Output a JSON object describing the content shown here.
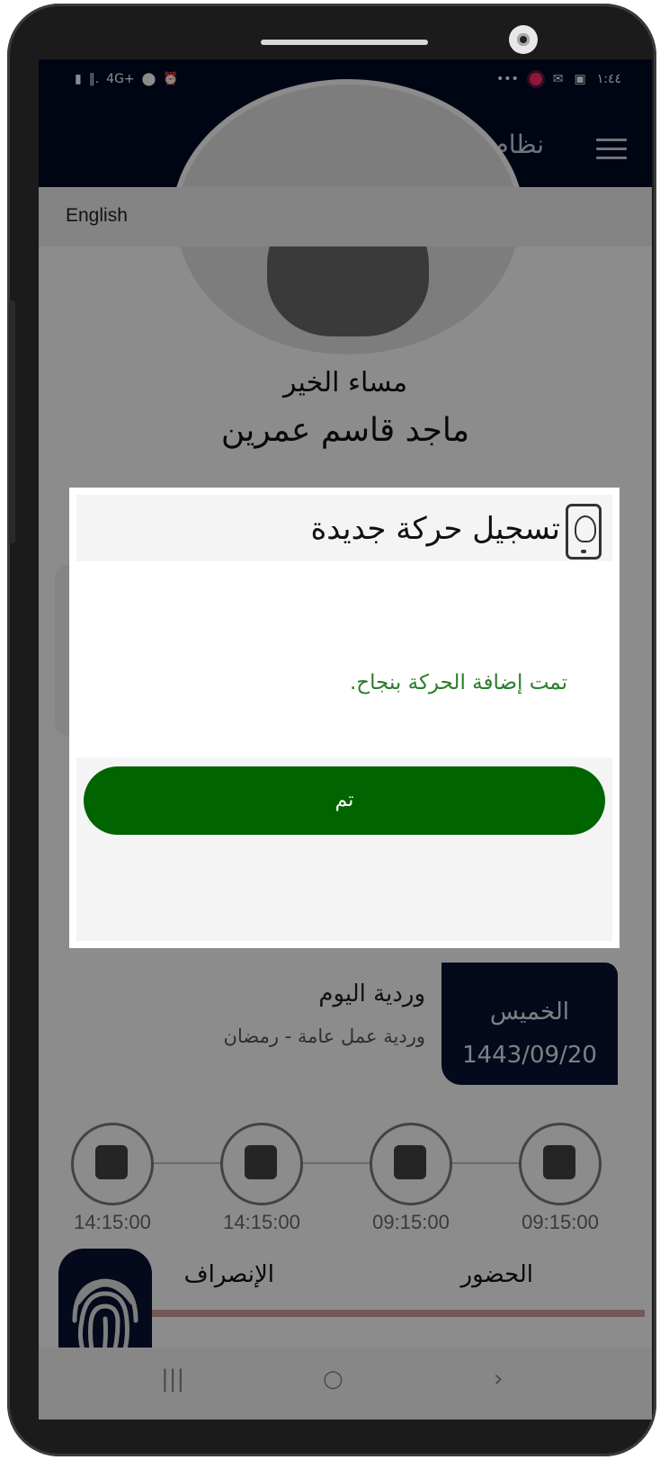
{
  "status_bar": {
    "left_icons": [
      "battery-icon",
      "signal-icon",
      "4g-icon",
      "location-icon",
      "alarm-icon"
    ],
    "left_text": "4G+",
    "right_icons": [
      "more-icon",
      "record-icon",
      "mail-icon",
      "image-icon"
    ],
    "time": "١:٤٤"
  },
  "app_bar": {
    "title": "نظام الحضور والإنصراف",
    "menu_icon": "menu-icon"
  },
  "language": {
    "label": "English"
  },
  "profile": {
    "greeting": "مساء الخير",
    "name": "ماجد قاسم عمرين"
  },
  "shift": {
    "title": "وردية اليوم",
    "description": "وردية عمل عامة - رمضان",
    "day": "الخميس",
    "date": "1443/09/20"
  },
  "timeline": [
    {
      "icon": "check-in-icon",
      "time": "09:15:00"
    },
    {
      "icon": "desk-work-icon",
      "time": "09:15:00"
    },
    {
      "icon": "break-icon",
      "time": "14:15:00"
    },
    {
      "icon": "check-out-icon",
      "time": "14:15:00"
    }
  ],
  "tabs": {
    "attendance": "الحضور",
    "departure": "الإنصراف"
  },
  "navbar": {
    "recent": "|||",
    "home": "○",
    "back": "›"
  },
  "dialog": {
    "title": "تسجيل حركة جديدة",
    "message": "تمت إضافة الحركة بنجاح.",
    "ok_label": "تم",
    "ok_color": "#006400",
    "message_color": "#2a7d2a"
  },
  "colors": {
    "primary_dark": "#000a26",
    "accent_red": "#d6a19c"
  }
}
